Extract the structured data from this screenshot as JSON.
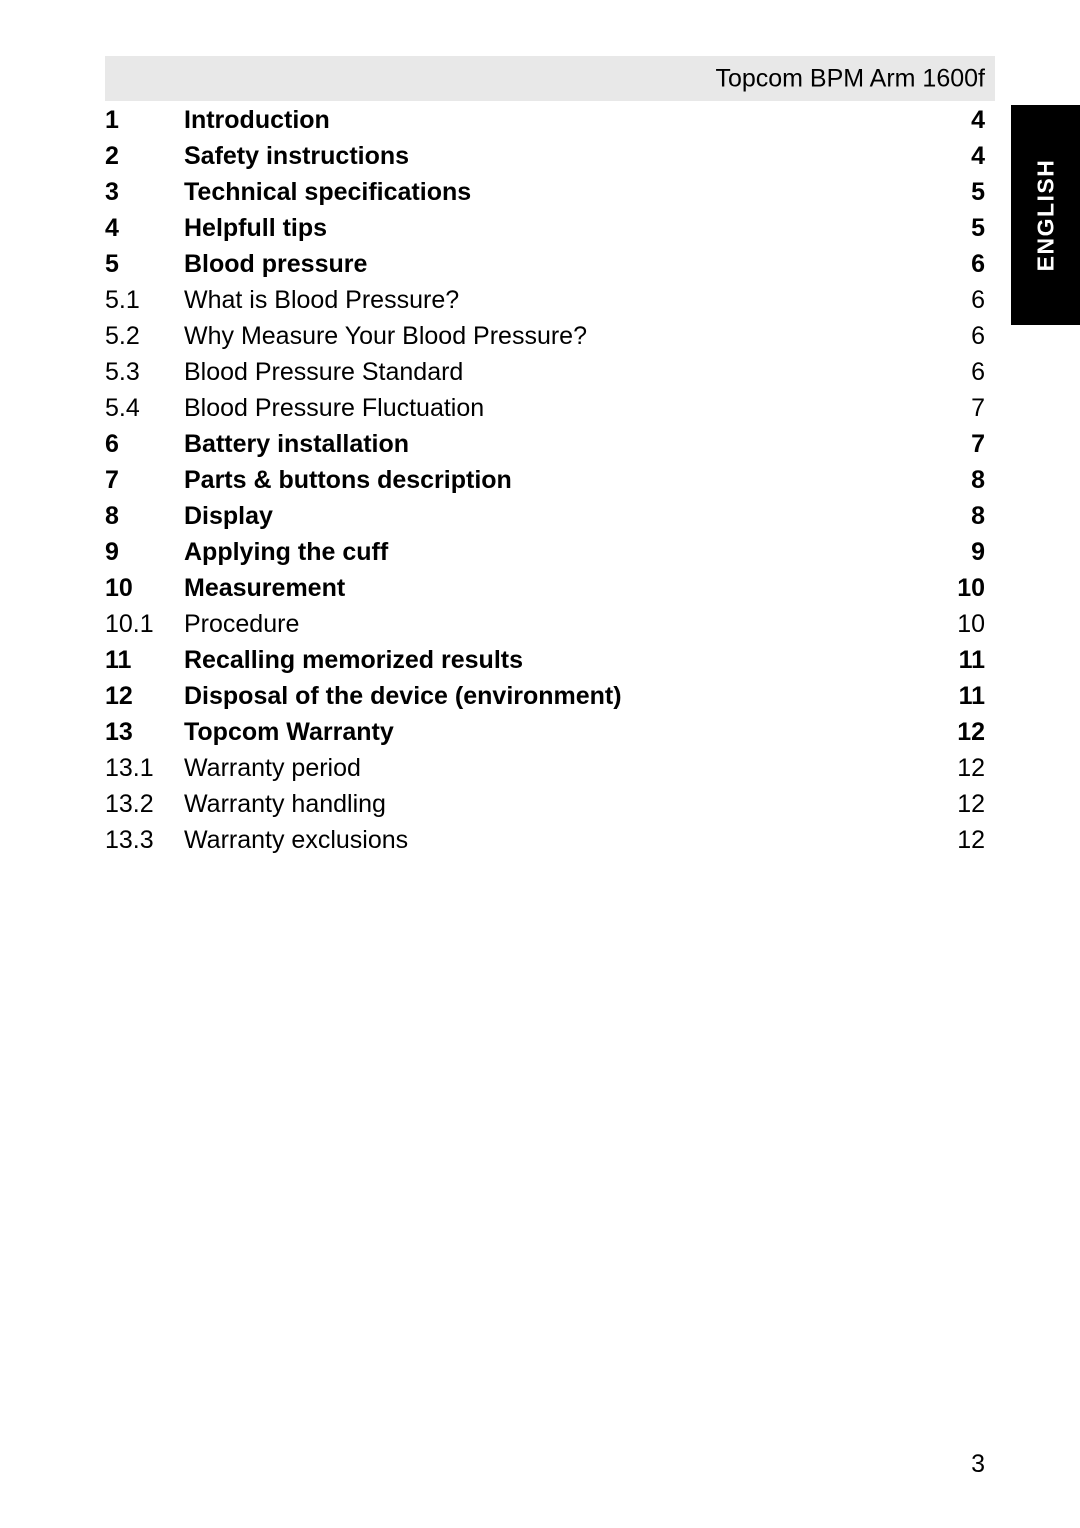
{
  "header": {
    "title": "Topcom BPM Arm 1600f",
    "band_color": "#e8e8e8"
  },
  "language_tab": {
    "label": "ENGLISH",
    "background_color": "#000000",
    "text_color": "#ffffff"
  },
  "toc": {
    "entries": [
      {
        "number": "1",
        "title": "Introduction",
        "page": "4",
        "level": 1
      },
      {
        "number": "2",
        "title": "Safety instructions",
        "page": "4",
        "level": 1
      },
      {
        "number": "3",
        "title": "Technical specifications",
        "page": "5",
        "level": 1
      },
      {
        "number": "4",
        "title": "Helpfull tips",
        "page": "5",
        "level": 1
      },
      {
        "number": "5",
        "title": "Blood pressure",
        "page": "6",
        "level": 1
      },
      {
        "number": "5.1",
        "title": "What is Blood Pressure?",
        "page": "6",
        "level": 2
      },
      {
        "number": "5.2",
        "title": "Why Measure Your Blood Pressure?",
        "page": "6",
        "level": 2
      },
      {
        "number": "5.3",
        "title": "Blood Pressure Standard",
        "page": "6",
        "level": 2
      },
      {
        "number": "5.4",
        "title": "Blood Pressure Fluctuation",
        "page": "7",
        "level": 2
      },
      {
        "number": "6",
        "title": "Battery installation",
        "page": "7",
        "level": 1
      },
      {
        "number": "7",
        "title": "Parts & buttons description",
        "page": "8",
        "level": 1
      },
      {
        "number": "8",
        "title": "Display",
        "page": "8",
        "level": 1
      },
      {
        "number": "9",
        "title": "Applying the cuff",
        "page": "9",
        "level": 1
      },
      {
        "number": "10",
        "title": "Measurement",
        "page": "10",
        "level": 1
      },
      {
        "number": "10.1",
        "title": "Procedure",
        "page": "10",
        "level": 2
      },
      {
        "number": "11",
        "title": "Recalling memorized results",
        "page": "11",
        "level": 1
      },
      {
        "number": "12",
        "title": "Disposal of the device (environment)",
        "page": "11",
        "level": 1
      },
      {
        "number": "13",
        "title": "Topcom Warranty",
        "page": "12",
        "level": 1
      },
      {
        "number": "13.1",
        "title": "Warranty period",
        "page": "12",
        "level": 2
      },
      {
        "number": "13.2",
        "title": "Warranty handling",
        "page": "12",
        "level": 2
      },
      {
        "number": "13.3",
        "title": "Warranty exclusions",
        "page": "12",
        "level": 2
      }
    ]
  },
  "footer": {
    "page_number": "3"
  }
}
